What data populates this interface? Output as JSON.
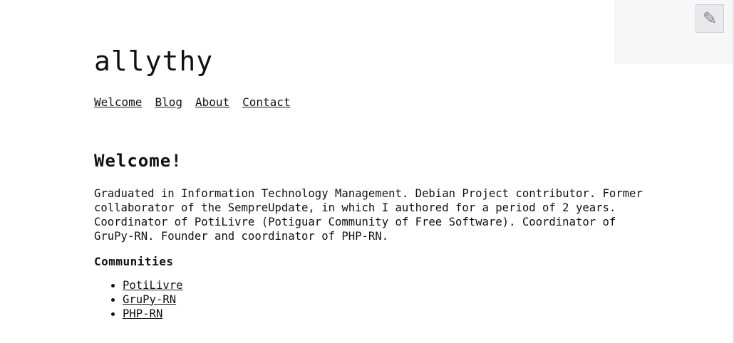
{
  "site": {
    "title": "allythy"
  },
  "nav": {
    "items": [
      {
        "label": "Welcome"
      },
      {
        "label": "Blog"
      },
      {
        "label": "About"
      },
      {
        "label": "Contact"
      }
    ]
  },
  "main": {
    "heading": "Welcome!",
    "intro": "Graduated in Information Technology Management. Debian Project contributor. Former collaborator of the SempreUpdate, in which I authored for a period of 2 years. Coordinator of PotiLivre (Potiguar Community of Free Software). Coordinator of GruPy-RN. Founder and coordinator of PHP-RN.",
    "communities_heading": "Communities",
    "communities": [
      {
        "label": "PotiLivre"
      },
      {
        "label": "GruPy-RN"
      },
      {
        "label": "PHP-RN"
      }
    ]
  },
  "edit": {
    "icon": "pencil-icon",
    "glyph": "✎"
  }
}
